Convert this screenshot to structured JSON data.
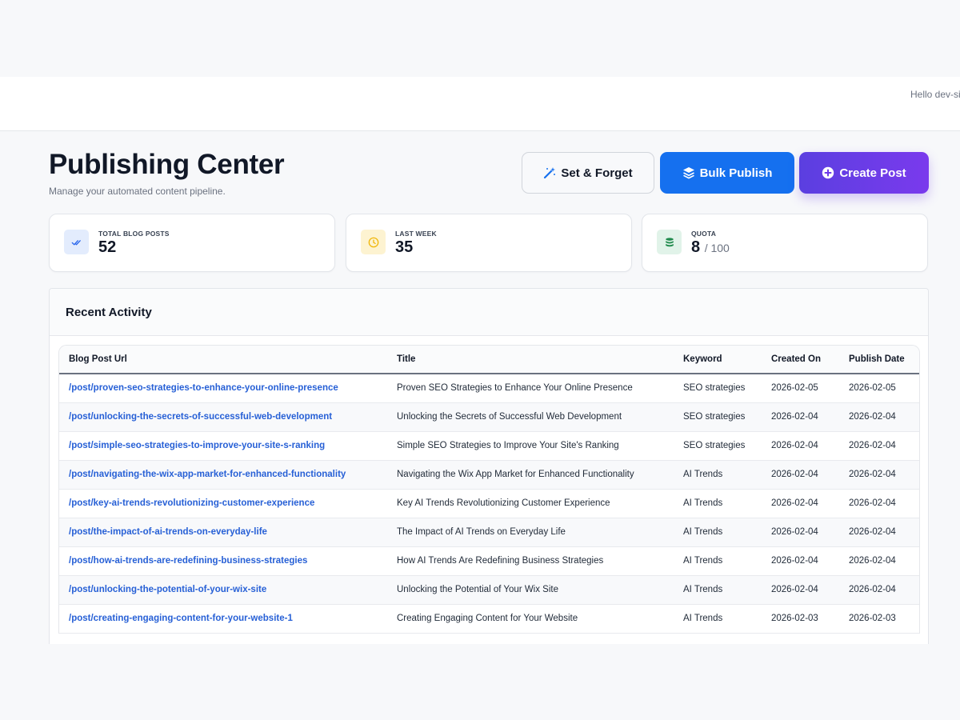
{
  "header": {
    "greeting": "Hello dev-si"
  },
  "page": {
    "title": "Publishing Center",
    "subtitle": "Manage your automated content pipeline."
  },
  "actions": {
    "set_forget": {
      "label": "Set & Forget",
      "icon": "magic-wand-icon"
    },
    "bulk_publish": {
      "label": "Bulk Publish",
      "icon": "layers-icon",
      "color": "#1570ef"
    },
    "create_post": {
      "label": "Create Post",
      "icon": "plus-circle-icon",
      "color": "#6d3ae8"
    }
  },
  "stats": [
    {
      "label": "TOTAL BLOG POSTS",
      "value": "52",
      "icon": "double-check-icon",
      "color": "#2563eb"
    },
    {
      "label": "LAST WEEK",
      "value": "35",
      "icon": "clock-icon",
      "color": "#f4c430"
    },
    {
      "label": "QUOTA",
      "value": "8",
      "suffix": "/ 100",
      "icon": "database-icon",
      "color": "#1f8a4c"
    }
  ],
  "activity": {
    "title": "Recent Activity",
    "columns": [
      "Blog Post Url",
      "Title",
      "Keyword",
      "Created On",
      "Publish Date"
    ],
    "rows": [
      [
        "/post/proven-seo-strategies-to-enhance-your-online-presence",
        "Proven SEO Strategies to Enhance Your Online Presence",
        "SEO strategies",
        "2026-02-05",
        "2026-02-05"
      ],
      [
        "/post/unlocking-the-secrets-of-successful-web-development",
        "Unlocking the Secrets of Successful Web Development",
        "SEO strategies",
        "2026-02-04",
        "2026-02-04"
      ],
      [
        "/post/simple-seo-strategies-to-improve-your-site-s-ranking",
        "Simple SEO Strategies to Improve Your Site's Ranking",
        "SEO strategies",
        "2026-02-04",
        "2026-02-04"
      ],
      [
        "/post/navigating-the-wix-app-market-for-enhanced-functionality",
        "Navigating the Wix App Market for Enhanced Functionality",
        "AI Trends",
        "2026-02-04",
        "2026-02-04"
      ],
      [
        "/post/key-ai-trends-revolutionizing-customer-experience",
        "Key AI Trends Revolutionizing Customer Experience",
        "AI Trends",
        "2026-02-04",
        "2026-02-04"
      ],
      [
        "/post/the-impact-of-ai-trends-on-everyday-life",
        "The Impact of AI Trends on Everyday Life",
        "AI Trends",
        "2026-02-04",
        "2026-02-04"
      ],
      [
        "/post/how-ai-trends-are-redefining-business-strategies",
        "How AI Trends Are Redefining Business Strategies",
        "AI Trends",
        "2026-02-04",
        "2026-02-04"
      ],
      [
        "/post/unlocking-the-potential-of-your-wix-site",
        "Unlocking the Potential of Your Wix Site",
        "AI Trends",
        "2026-02-04",
        "2026-02-04"
      ],
      [
        "/post/creating-engaging-content-for-your-website-1",
        "Creating Engaging Content for Your Website",
        "AI Trends",
        "2026-02-03",
        "2026-02-03"
      ]
    ]
  }
}
